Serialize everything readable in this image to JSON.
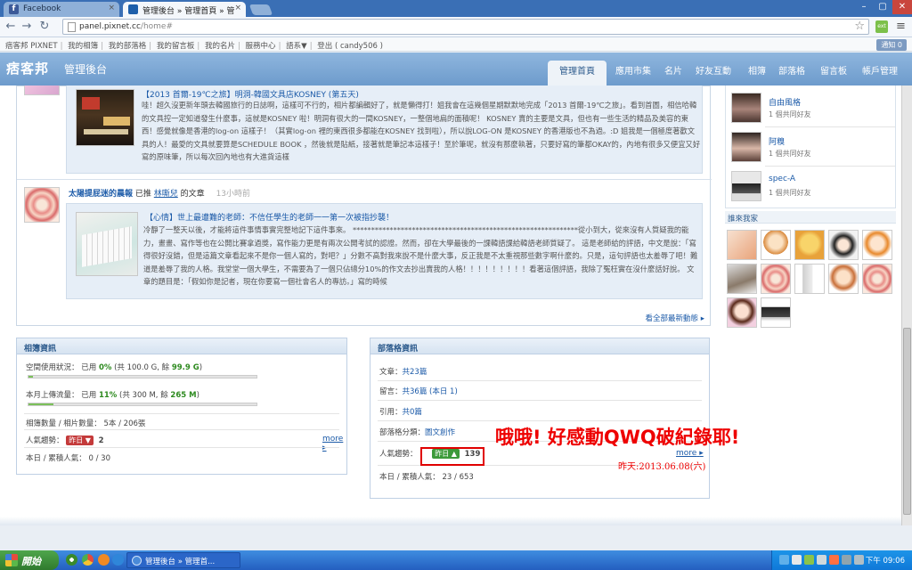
{
  "browser": {
    "tabs": [
      {
        "label": "Facebook",
        "favicon": "facebook-icon"
      },
      {
        "label": "管理後台 » 管理首頁 » 管",
        "favicon": "pixnet-icon"
      }
    ],
    "url_host": "panel.pixnet.cc",
    "url_path": "/home#"
  },
  "topbar": {
    "links": [
      "痞客邦 PIXNET",
      "我的相簿",
      "我的部落格",
      "我的留言板",
      "我的名片",
      "服務中心",
      "語系▼",
      "登出 ( candy506 )"
    ],
    "notify": "通知 0"
  },
  "header": {
    "logo": "痞客邦",
    "subtitle": "管理後台",
    "nav": [
      "管理首頁",
      "應用市集",
      "名片",
      "好友互動",
      "相簿",
      "部落格",
      "留言板",
      "帳戶管理"
    ]
  },
  "feed": {
    "post1": {
      "title": "【2013 首爾-19℃之旅】明洞-韓國文具店KOSNEY (第五天)",
      "body": "哇！超久沒更新年頭去韓國旅行的日誌啊，這樣可不行的，相片都編輯好了，就是懶得打！姐我會在這幾個星期默默地完成「2013 首爾-19℃之旅」。看到首圖，相信哈韓的文具控一定知道發生什麼事，這就是KOSNEY 啦！明洞有很大的一間KOSNEY，一整個地扁的面積呢！ KOSNEY 賣的主要是文具，但也有一些生活的精品及美容的東西！感覺就像是香港的log-on 這樣子！（其實log-on 裡的東西很多都能在KOSNEY 找到啦），所以說LOG-ON 是KOSNEY 的香港版也不為過。:D 姐我是一個極度著歡文具的人！最愛的文具就要算是SCHEDULE BOOK ，然後就是貼紙，接著就是筆記本這樣子！至於筆呢，就沒有那麼執著，只要好寫的筆都OKAY的，內地有很多又便宜又好寫的原味筆，所以每次回內地也有大進貨這樣"
    },
    "post2": {
      "author": "太陽提屁迷的晨報",
      "verb": "已推",
      "target": "林嘶兒",
      "suffix": "的文章",
      "time": "13小時前",
      "title": "【心情】世上最遭難的老師：不信任學生的老師一一第一次被指抄襲！",
      "body": "冷靜了一整天以後，才能將這件事情事實完整地記下這件事來。 *************************************************************從小到大，從來沒有人質疑我的能力，畫畫、寫作等也在公開比賽拿過獎，寫作能力更是有兩次公開考試的認證。然而，卻在大學最後的一課韓語課給韓語老師質疑了。 這是老師給的評語，中文是說：「寫得很好沒錯，但是這篇文章看起來不是你一個人寫的，對吧？」分數不高對我來說不是什麼大事，反正我是不太重視那些數字啊什麼的。只是，這句評語也太羞辱了吧！難道是羞辱了我的人格。我堂堂一個大學生，不需要為了一個只佔總分10%的作文去抄出賣我的人格！！！！！！！！！看著這個評語，我除了冤枉實在沒什麼話好說。 文章的題目是：「假如你是記者，現在你要寫一個社會名人的專訪。」寫的時候"
    },
    "see_all": "看全部最新動態"
  },
  "album_stats": {
    "title": "相簿資訊",
    "space_label": "空間使用狀況：",
    "space_used_word": "已用",
    "space_pct": "0%",
    "space_detail_open": "(共",
    "space_total": "100.0 G",
    "space_remaining_label": ", 餘",
    "space_remaining": "99.9 G",
    "space_close": ")",
    "space_fraction": 0.003,
    "upload_label": "本月上傳流量：",
    "upload_used_word": "已用",
    "upload_pct": "11%",
    "upload_detail_open": "(共",
    "upload_total": "300 M",
    "upload_remaining_label": ", 餘",
    "upload_remaining": "265 M",
    "upload_close": ")",
    "upload_fraction": 0.11,
    "count_label": "相簿數量 / 相片數量：",
    "count_value": "5本 / 206張",
    "trend_label": "人氣趨勢：",
    "trend_badge": "昨日",
    "trend_value": "2",
    "more": "more",
    "visits_label": "本日 / 累積人氣：",
    "visits_value": "0 / 30"
  },
  "blog_stats": {
    "title": "部落格資訊",
    "articles_label": "文章：",
    "articles_value": "共23篇",
    "comments_label": "留言：",
    "comments_value": "共36篇 (本日 1)",
    "trackback_label": "引用：",
    "trackback_value": "共0篇",
    "category_label": "部落格分類：",
    "category_value": "圖文創作",
    "trend_label": "人氣趨勢：",
    "trend_badge": "昨日",
    "trend_value": "139",
    "more": "more",
    "visits_label": "本日 / 累積人氣：",
    "visits_value": "23 / 653"
  },
  "annotation": {
    "text": "哦哦! 好感動QWQ破紀錄耶!",
    "date": "昨天:2013.06.08(六)",
    "color": "#ee0000"
  },
  "friends": [
    {
      "name": "自由風格",
      "sub": "1 個共同好友"
    },
    {
      "name": "阿糗",
      "sub": "1 個共同好友"
    },
    {
      "name": "spec-A",
      "sub": "1 個共同好友"
    }
  ],
  "visitors_title": "誰來我家",
  "taskbar": {
    "start": "開始",
    "task": "管理後台 » 管理首...",
    "clock": "下午 09:06"
  },
  "colors": {
    "header": "#7aa6d4",
    "accent_link": "#1b5aa8",
    "badge_green": "#3c9a3a",
    "badge_red": "#c43a3a"
  }
}
